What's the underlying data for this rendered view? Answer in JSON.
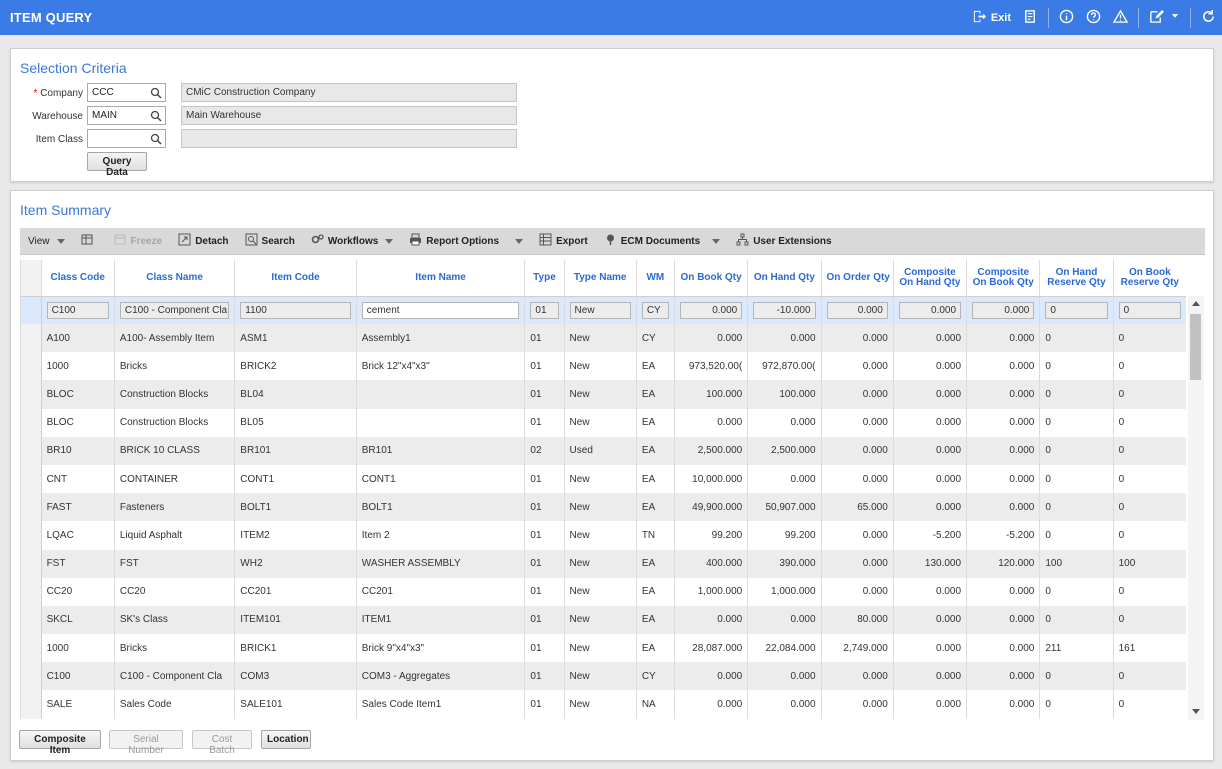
{
  "titlebar": {
    "title": "ITEM QUERY",
    "exit_label": "Exit",
    "icons": [
      "exit-icon",
      "print-icon",
      "info-icon",
      "help-icon",
      "warning-icon",
      "edit-icon",
      "chevron-down-icon",
      "refresh-icon"
    ]
  },
  "selection": {
    "title": "Selection Criteria",
    "company_label": "Company",
    "required_mark": "*",
    "company_value": "CCC",
    "company_desc": "CMiC Construction Company",
    "warehouse_label": "Warehouse",
    "warehouse_value": "MAIN",
    "warehouse_desc": "Main Warehouse",
    "item_class_label": "Item Class",
    "item_class_value": "",
    "item_class_desc": "",
    "query_button": "Query Data"
  },
  "summary": {
    "title": "Item Summary",
    "toolbar": {
      "view": "View",
      "freeze": "Freeze",
      "detach": "Detach",
      "search": "Search",
      "workflows": "Workflows",
      "report_options": "Report Options",
      "export": "Export",
      "ecm_documents": "ECM Documents",
      "user_extensions": "User Extensions"
    },
    "columns": [
      {
        "l1": "Class Code",
        "l2": ""
      },
      {
        "l1": "Class Name",
        "l2": ""
      },
      {
        "l1": "Item Code",
        "l2": ""
      },
      {
        "l1": "Item Name",
        "l2": ""
      },
      {
        "l1": "Type",
        "l2": ""
      },
      {
        "l1": "Type Name",
        "l2": ""
      },
      {
        "l1": "WM",
        "l2": ""
      },
      {
        "l1": "On Book Qty",
        "l2": ""
      },
      {
        "l1": "On Hand Qty",
        "l2": ""
      },
      {
        "l1": "On Order Qty",
        "l2": ""
      },
      {
        "l1": "Composite",
        "l2": "On Hand Qty"
      },
      {
        "l1": "Composite",
        "l2": "On Book Qty"
      },
      {
        "l1": "On Hand",
        "l2": "Reserve Qty"
      },
      {
        "l1": "On Book",
        "l2": "Reserve Qty"
      }
    ],
    "filter_row": [
      "C100",
      "C100 - Component Cla",
      "1100",
      "cement",
      "01",
      "New",
      "CY",
      "0.000",
      "-10.000",
      "0.000",
      "0.000",
      "0.000",
      "0",
      "0"
    ],
    "rows": [
      [
        "A100",
        "A100- Assembly Item",
        "ASM1",
        "Assembly1",
        "01",
        "New",
        "CY",
        "0.000",
        "0.000",
        "0.000",
        "0.000",
        "0.000",
        "0",
        "0"
      ],
      [
        "1000",
        "Bricks",
        "BRICK2",
        "Brick 12\"x4\"x3\"",
        "01",
        "New",
        "EA",
        "973,520.00(",
        "972,870.00(",
        "0.000",
        "0.000",
        "0.000",
        "0",
        "0"
      ],
      [
        "BLOC",
        "Construction Blocks",
        "BL04",
        "",
        "01",
        "New",
        "EA",
        "100.000",
        "100.000",
        "0.000",
        "0.000",
        "0.000",
        "0",
        "0"
      ],
      [
        "BLOC",
        "Construction Blocks",
        "BL05",
        "",
        "01",
        "New",
        "EA",
        "0.000",
        "0.000",
        "0.000",
        "0.000",
        "0.000",
        "0",
        "0"
      ],
      [
        "BR10",
        "BRICK 10 CLASS",
        "BR101",
        "BR101",
        "02",
        "Used",
        "EA",
        "2,500.000",
        "2,500.000",
        "0.000",
        "0.000",
        "0.000",
        "0",
        "0"
      ],
      [
        "CNT",
        "CONTAINER",
        "CONT1",
        "CONT1",
        "01",
        "New",
        "EA",
        "10,000.000",
        "0.000",
        "0.000",
        "0.000",
        "0.000",
        "0",
        "0"
      ],
      [
        "FAST",
        "Fasteners",
        "BOLT1",
        "BOLT1",
        "01",
        "New",
        "EA",
        "49,900.000",
        "50,907.000",
        "65.000",
        "0.000",
        "0.000",
        "0",
        "0"
      ],
      [
        "LQAC",
        "Liquid Asphalt",
        "ITEM2",
        "Item 2",
        "01",
        "New",
        "TN",
        "99.200",
        "99.200",
        "0.000",
        "-5.200",
        "-5.200",
        "0",
        "0"
      ],
      [
        "FST",
        "FST",
        "WH2",
        "WASHER ASSEMBLY",
        "01",
        "New",
        "EA",
        "400.000",
        "390.000",
        "0.000",
        "130.000",
        "120.000",
        "100",
        "100"
      ],
      [
        "CC20",
        "CC20",
        "CC201",
        "CC201",
        "01",
        "New",
        "EA",
        "1,000.000",
        "1,000.000",
        "0.000",
        "0.000",
        "0.000",
        "0",
        "0"
      ],
      [
        "SKCL",
        "SK's Class",
        "ITEM101",
        "ITEM1",
        "01",
        "New",
        "EA",
        "0.000",
        "0.000",
        "80.000",
        "0.000",
        "0.000",
        "0",
        "0"
      ],
      [
        "1000",
        "Bricks",
        "BRICK1",
        "Brick 9\"x4\"x3\"",
        "01",
        "New",
        "EA",
        "28,087.000",
        "22,084.000",
        "2,749.000",
        "0.000",
        "0.000",
        "211",
        "161"
      ],
      [
        "C100",
        "C100 - Component Cla",
        "COM3",
        "COM3 - Aggregates",
        "01",
        "New",
        "CY",
        "0.000",
        "0.000",
        "0.000",
        "0.000",
        "0.000",
        "0",
        "0"
      ],
      [
        "SALE",
        "Sales Code",
        "SALE101",
        "Sales Code Item1",
        "01",
        "New",
        "NA",
        "0.000",
        "0.000",
        "0.000",
        "0.000",
        "0.000",
        "0",
        "0"
      ]
    ],
    "buttons": {
      "composite_item": "Composite Item",
      "serial_number": "Serial Number",
      "cost_batch": "Cost Batch",
      "location": "Location"
    }
  }
}
